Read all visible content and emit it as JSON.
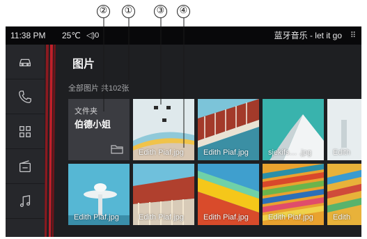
{
  "callouts": [
    "②",
    "①",
    "③",
    "④"
  ],
  "statusbar": {
    "time": "11:38 PM",
    "temperature": "25℃",
    "volume": "◁)0",
    "now_playing": "蓝牙音乐 - let it go",
    "menu_icon": "grid-dots-icon"
  },
  "sidebar": {
    "items": [
      {
        "icon": "car-icon"
      },
      {
        "icon": "phone-icon"
      },
      {
        "icon": "apps-grid-icon"
      },
      {
        "icon": "radio-icon"
      },
      {
        "icon": "music-note-icon"
      }
    ]
  },
  "gallery": {
    "title": "图片",
    "count_text": "全部图片 共102张",
    "folder": {
      "label": "文件夹",
      "name": "伯德小姐",
      "icon": "folder-icon"
    },
    "row1": [
      {
        "name": "Edith Piaf.jpg"
      },
      {
        "name": "Edith Piaf.jpg"
      },
      {
        "name": "sjekifs… .jpg"
      },
      {
        "name": "Edith"
      }
    ],
    "row2": [
      {
        "name": "Edith Piaf.jpg"
      },
      {
        "name": "Edith Piaf.jpg"
      },
      {
        "name": "Edith Piaf.jpg"
      },
      {
        "name": "Edith Piaf.jpg"
      },
      {
        "name": "Edith"
      }
    ]
  },
  "colors": {
    "screen_bg": "#1e1f22",
    "sidebar_bg": "#26272b",
    "accent_red": "#c0202a"
  }
}
